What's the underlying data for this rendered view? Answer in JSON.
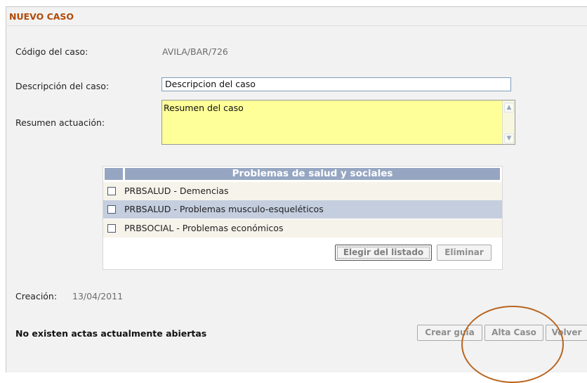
{
  "page": {
    "title": "NUEVO CASO"
  },
  "form": {
    "codigo_label": "Código del caso:",
    "codigo_value": "AVILA/BAR/726",
    "descripcion_label": "Descripción del caso:",
    "descripcion_value": "Descripcion del caso",
    "resumen_label": "Resumen actuación:",
    "resumen_value": "Resumen del caso"
  },
  "problems": {
    "header": "Problemas de salud y sociales",
    "items": [
      {
        "label": "PRBSALUD  - Demencias",
        "checked": false
      },
      {
        "label": "PRBSALUD  - Problemas musculo-esqueléticos",
        "checked": false,
        "selected": true
      },
      {
        "label": "PRBSOCIAL - Problemas económicos",
        "checked": false
      }
    ],
    "elegir_label": "Elegir del listado",
    "eliminar_label": "Eliminar"
  },
  "creacion": {
    "label": "Creación:",
    "value": "13/04/2011"
  },
  "actas_message": "No existen actas actualmente abiertas",
  "actions": {
    "crear_guia": "Crear guía",
    "alta_caso": "Alta Caso",
    "volver": "Volver"
  },
  "colors": {
    "title": "#b04a08",
    "header_bg": "#96a6c2",
    "selected_row": "#c4cedf",
    "textarea_bg": "#ffff99",
    "highlight_circle": "#b8651f"
  }
}
